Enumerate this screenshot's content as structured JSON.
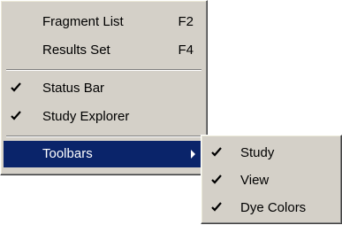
{
  "menu": {
    "items": [
      {
        "label": "Fragment List",
        "shortcut": "F2"
      },
      {
        "label": "Results Set",
        "shortcut": "F4"
      },
      {
        "label": "Status Bar",
        "checked": true
      },
      {
        "label": "Study Explorer",
        "checked": true
      },
      {
        "label": "Toolbars",
        "has_submenu": true,
        "highlighted": true
      }
    ]
  },
  "submenu": {
    "items": [
      {
        "label": "Study",
        "checked": true
      },
      {
        "label": "View",
        "checked": true
      },
      {
        "label": "Dye Colors",
        "checked": true
      }
    ]
  },
  "colors": {
    "menu_background": "#d4d0c8",
    "highlight_background": "#0a246a",
    "highlight_text": "#ffffff"
  }
}
